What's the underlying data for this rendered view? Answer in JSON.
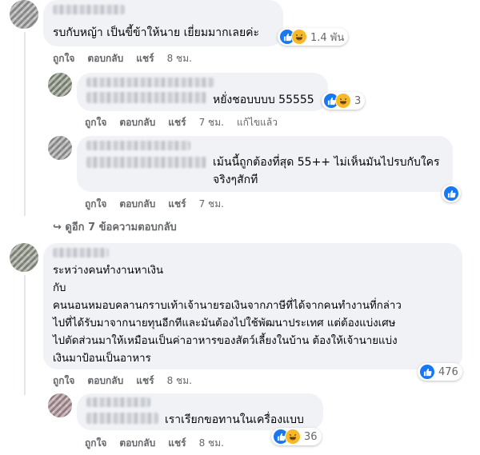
{
  "comments": [
    {
      "text": "รบกับหญ้า เป็นขี้ข้าให้นาย เยี่ยมมากเลยค่ะ",
      "reaction_count": "1.4 พัน",
      "actions": [
        "ถูกใจ",
        "ตอบกลับ",
        "แชร์",
        "8 ชม."
      ]
    },
    {
      "text": "หยั่งชอบบบบ 55555",
      "reaction_count": "3",
      "actions": [
        "ถูกใจ",
        "ตอบกลับ",
        "แชร์",
        "7 ชม.",
        "แก้ไขแล้ว"
      ]
    },
    {
      "text": "เม้นนี้ถูกต้องที่สุด 55++ ไม่เห็นมันไปรบกับใคร\nจริงๆสักที",
      "actions": [
        "ถูกใจ",
        "ตอบกลับ",
        "แชร์",
        "7 ชม."
      ]
    },
    {
      "text": "ระหว่างคนทำงานหาเงิน\nกับ\nคนนอนหมอบคลานกราบเท้าเจ้านายรอเงินจากภาษีที่ได้จากคนทำงานที่กล่าว\nไปที่ได้รับมาจากนายทุนอีกทีและมันต้องไปใช้พัฒนาประเทศ แต่ต้องแบ่งเศษ\nไปตัดส่วนมาให้เหมือนเป็นค่าอาหารของสัตว์เลี้ยงในบ้าน ต้องให้เจ้านายแบ่ง\nเงินมาป้อนเป็นอาหาร",
      "reaction_count": "476",
      "actions": [
        "ถูกใจ",
        "ตอบกลับ",
        "แชร์",
        "8 ชม."
      ]
    },
    {
      "text": "เราเรียกขอทานในเครื่องแบบ",
      "reaction_count": "36",
      "actions": [
        "ถูกใจ",
        "ตอบกลับ",
        "แชร์",
        "8 ชม."
      ]
    }
  ],
  "view_more_replies": "ดูอีก 7 ข้อความตอบกลับ",
  "colors": {
    "like": "#1877f2",
    "haha": "#f7b928",
    "bubble": "#f0f2f5",
    "meta": "#65676b"
  }
}
